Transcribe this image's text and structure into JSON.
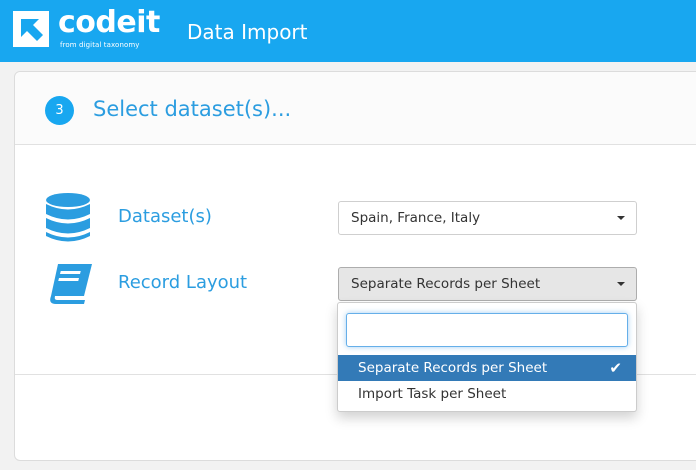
{
  "header": {
    "logo_text": "codeit",
    "logo_subtitle": "from digital taxonomy",
    "app_title": "Data Import"
  },
  "step": {
    "number": "3",
    "title": "Select dataset(s)..."
  },
  "fields": {
    "datasets": {
      "label": "Dataset(s)",
      "value": "Spain, France, Italy",
      "icon": "database-icon"
    },
    "record_layout": {
      "label": "Record Layout",
      "value": "Separate Records per Sheet",
      "icon": "book-icon"
    }
  },
  "dropdown": {
    "search_value": "",
    "search_placeholder": "",
    "options": [
      {
        "label": "Separate Records per Sheet",
        "selected": true
      },
      {
        "label": "Import Task per Sheet",
        "selected": false
      }
    ]
  },
  "colors": {
    "brand": "#18a7f0",
    "label_blue": "#2b9de0",
    "selected_option": "#337ab7"
  }
}
